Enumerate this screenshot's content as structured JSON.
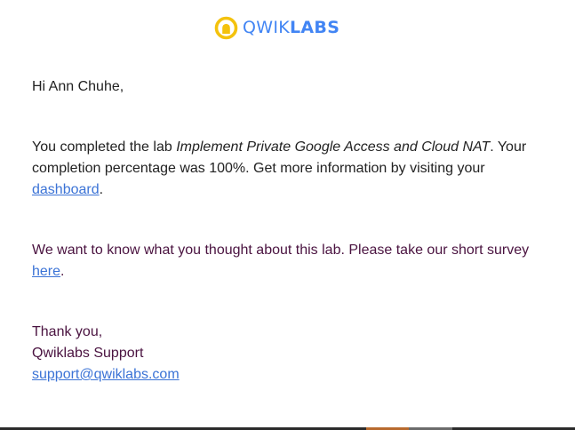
{
  "logo": {
    "text_light": "QWIK",
    "text_bold": "LABS",
    "ring_color": "#f4c20d",
    "inner_color": "#f4c20d",
    "text_color": "#4285f4"
  },
  "email": {
    "greeting": "Hi Ann Chuhe,",
    "completed_prefix": "You completed the lab ",
    "lab_name": "Implement Private Google Access and Cloud NAT",
    "completed_middle": ". Your completion percentage was 100%. Get more information by visiting your ",
    "dashboard_link": "dashboard",
    "completed_suffix": ".",
    "survey_prefix": "We want to know what you thought about this lab. Please take our short survey ",
    "survey_link": "here",
    "survey_suffix": ".",
    "thanks": "Thank you,",
    "signature": "Qwiklabs Support",
    "support_email": "support@qwiklabs.com"
  },
  "colors": {
    "link": "#3b73d6",
    "accent_text": "#4a1340"
  }
}
